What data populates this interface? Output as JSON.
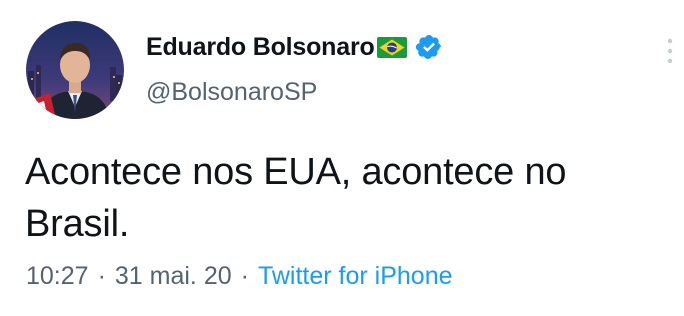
{
  "tweet": {
    "author": {
      "display_name": "Eduardo Bolsonaro",
      "flag_icon": "brazil-flag-icon",
      "verified_icon": "verified-badge-icon",
      "handle": "@BolsonaroSP"
    },
    "more_icon": "more-vertical-icon",
    "text": "Acontece nos EUA, acontece no Brasil.",
    "meta": {
      "time": "10:27",
      "separator": "·",
      "date": "31 mai. 20",
      "source": "Twitter for iPhone"
    }
  },
  "colors": {
    "text_primary": "#0f1419",
    "text_secondary": "#536471",
    "link": "#1d9bf0",
    "verified": "#1d9bf0"
  }
}
